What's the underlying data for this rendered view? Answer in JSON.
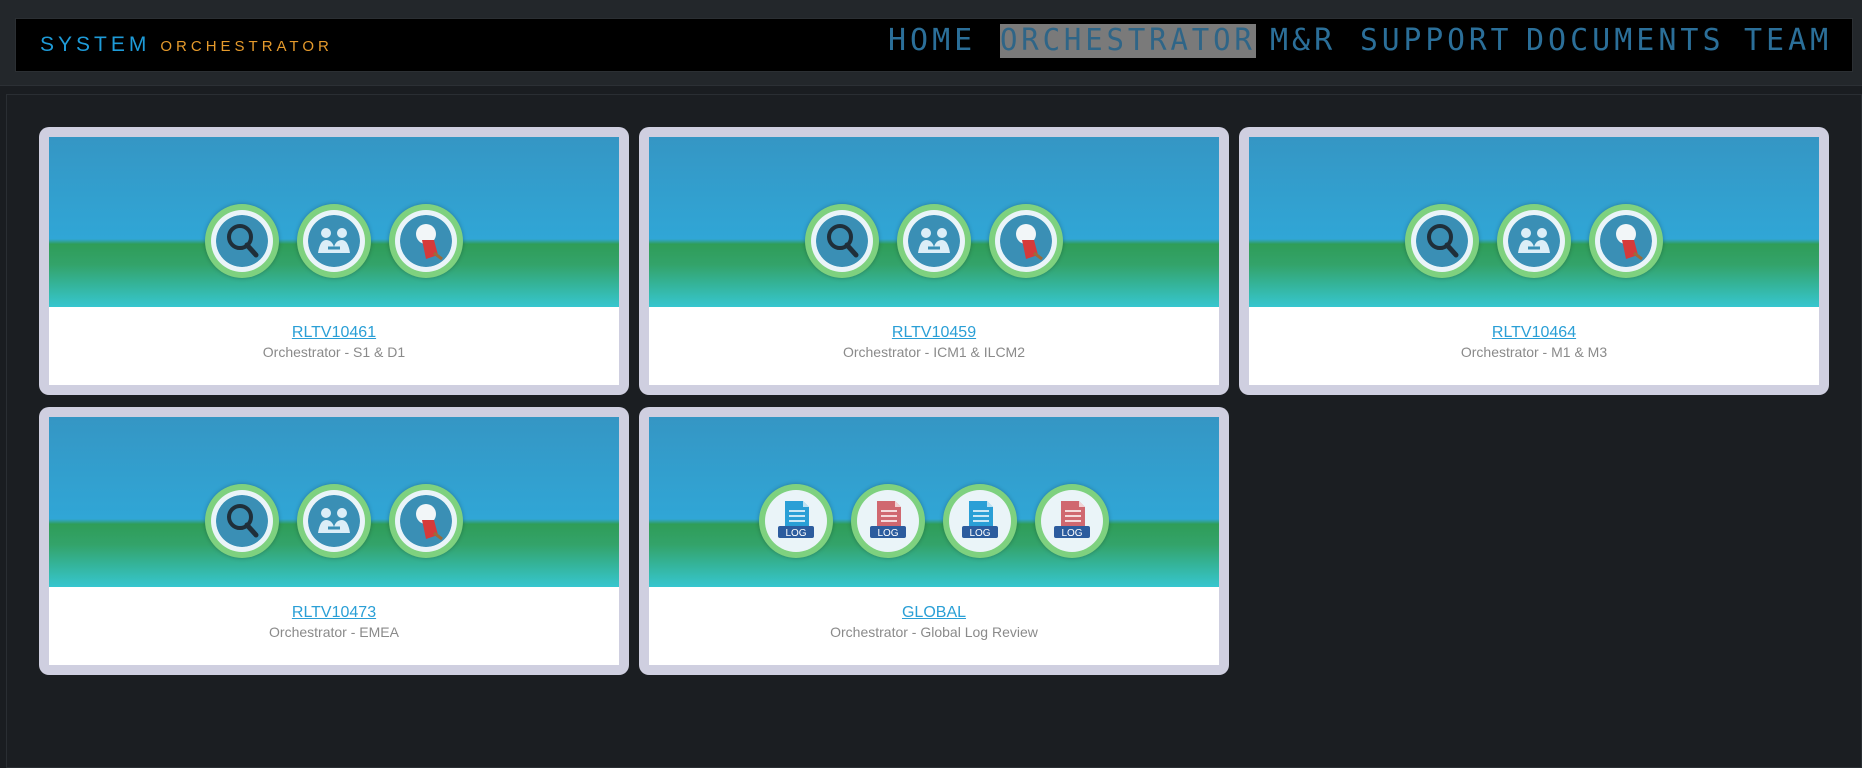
{
  "brand": {
    "system": "SYSTEM",
    "orchestrator": "ORCHESTRATOR"
  },
  "nav": [
    {
      "label": "HOME",
      "active": false
    },
    {
      "label": "ORCHESTRATOR",
      "active": true
    },
    {
      "label": "M&R",
      "active": false
    },
    {
      "label": "SUPPORT",
      "active": false
    },
    {
      "label": "DOCUMENTS",
      "active": false
    },
    {
      "label": "TEAM",
      "active": false
    }
  ],
  "cards": [
    {
      "title": "RLTV10461",
      "subtitle": "Orchestrator - S1 & D1",
      "icons": [
        "magnifier-icon",
        "people-icon",
        "map-pin-icon"
      ]
    },
    {
      "title": "RLTV10459",
      "subtitle": "Orchestrator - ICM1 & ILCM2",
      "icons": [
        "magnifier-icon",
        "people-icon",
        "map-pin-icon"
      ]
    },
    {
      "title": "RLTV10464",
      "subtitle": "Orchestrator - M1 & M3",
      "icons": [
        "magnifier-icon",
        "people-icon",
        "map-pin-icon"
      ]
    },
    {
      "title": "RLTV10473",
      "subtitle": "Orchestrator - EMEA",
      "icons": [
        "magnifier-icon",
        "people-icon",
        "map-pin-icon"
      ]
    },
    {
      "title": "GLOBAL",
      "subtitle": "Orchestrator - Global Log Review",
      "icons": [
        "log-blue-icon",
        "log-red-icon",
        "log-blue-icon",
        "log-red-icon"
      ]
    }
  ],
  "log_label": "LOG",
  "colors": {
    "brand_system": "#1e9bd8",
    "brand_orchestrator": "#e59a2c",
    "nav": "#2b6f99",
    "nav_active_bg": "#7a7a7a",
    "link": "#2a9fd6"
  }
}
